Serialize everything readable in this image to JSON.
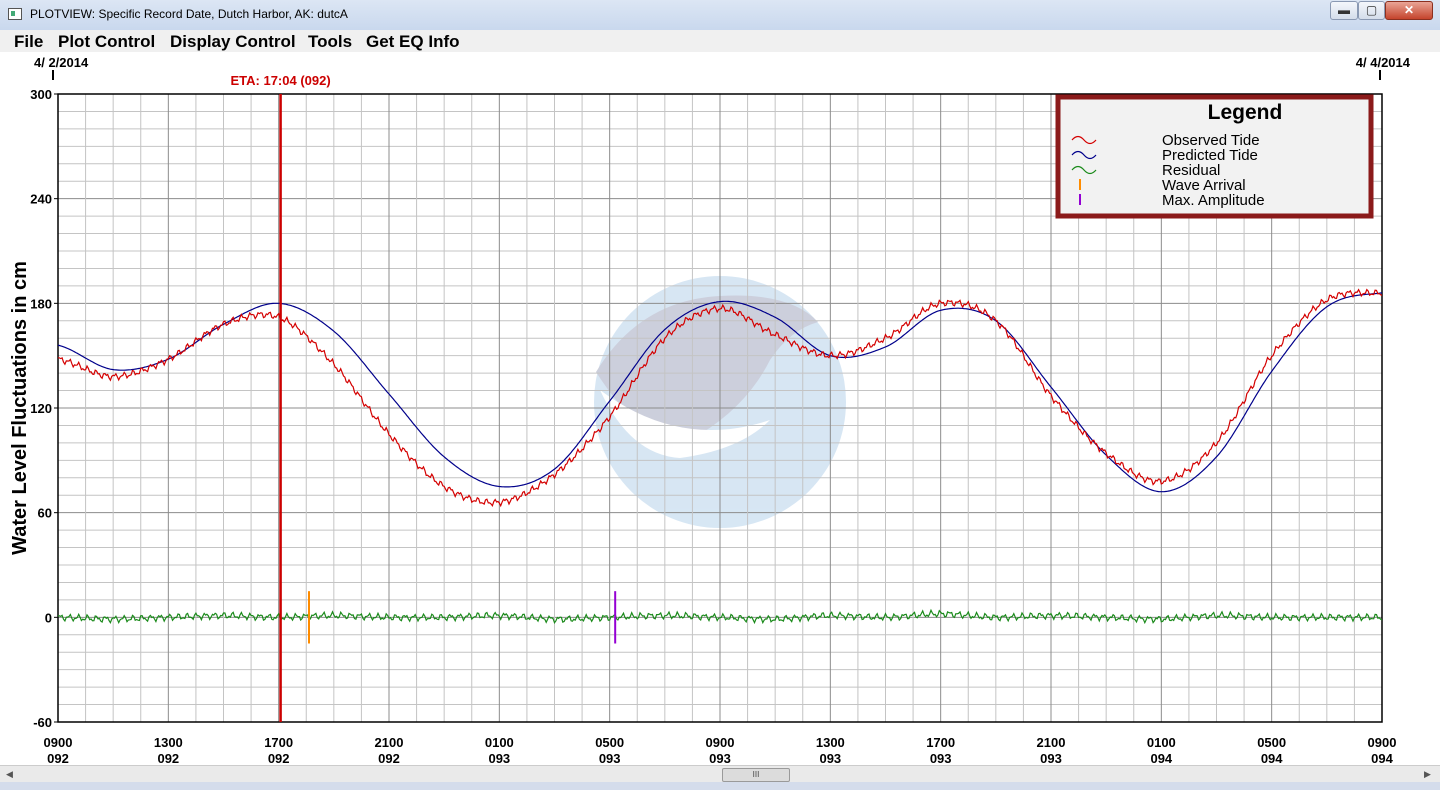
{
  "window": {
    "title": "PLOTVIEW: Specific Record Date, Dutch Harbor, AK: dutcA",
    "minimize_label": "▬",
    "maximize_label": "▢",
    "close_label": "✕"
  },
  "menu": {
    "items": [
      "File",
      "Plot Control",
      "Display Control",
      "Tools",
      "Get EQ Info"
    ]
  },
  "scrollbar": {
    "left_arrow": "◀",
    "right_arrow": "▶",
    "thumb_grip": "III"
  },
  "chart_data": {
    "type": "line",
    "ylabel": "Water Level Fluctuations in cm",
    "ylim": [
      -60,
      300
    ],
    "yticks": [
      -60,
      0,
      60,
      120,
      180,
      240,
      300
    ],
    "xlim_hours": [
      0,
      48
    ],
    "xticks": [
      {
        "hour": 0,
        "time": "0900",
        "day": "092"
      },
      {
        "hour": 4,
        "time": "1300",
        "day": "092"
      },
      {
        "hour": 8,
        "time": "1700",
        "day": "092"
      },
      {
        "hour": 12,
        "time": "2100",
        "day": "092"
      },
      {
        "hour": 16,
        "time": "0100",
        "day": "093"
      },
      {
        "hour": 20,
        "time": "0500",
        "day": "093"
      },
      {
        "hour": 24,
        "time": "0900",
        "day": "093"
      },
      {
        "hour": 28,
        "time": "1300",
        "day": "093"
      },
      {
        "hour": 32,
        "time": "1700",
        "day": "093"
      },
      {
        "hour": 36,
        "time": "2100",
        "day": "093"
      },
      {
        "hour": 40,
        "time": "0100",
        "day": "094"
      },
      {
        "hour": 44,
        "time": "0500",
        "day": "094"
      },
      {
        "hour": 48,
        "time": "0900",
        "day": "094"
      }
    ],
    "date_start": "4/ 2/2014",
    "date_end": "4/ 4/2014",
    "eta": {
      "label": "ETA: 17:04 (092)",
      "hour": 8.07
    },
    "wave_arrival_hour": 9.1,
    "max_amplitude_hour": 20.2,
    "grid": true,
    "legend": {
      "title": "Legend",
      "placement": "top-right",
      "entries": [
        {
          "name": "Observed Tide",
          "color": "#d40000",
          "marker": "wave"
        },
        {
          "name": "Predicted Tide",
          "color": "#00008b",
          "marker": "wave"
        },
        {
          "name": "Residual",
          "color": "#1a8a1a",
          "marker": "wave"
        },
        {
          "name": "Wave Arrival",
          "color": "#ff8c00",
          "marker": "bar"
        },
        {
          "name": "Max. Amplitude",
          "color": "#9400d3",
          "marker": "bar"
        }
      ]
    },
    "series": [
      {
        "name": "Predicted Tide",
        "color": "#00008b",
        "x": [
          0,
          2,
          4,
          6,
          8,
          10,
          12,
          14,
          16,
          18,
          20,
          22,
          24,
          26,
          28,
          30,
          32,
          34,
          36,
          38,
          40,
          42,
          44,
          46,
          48
        ],
        "y": [
          156,
          142,
          148,
          168,
          180,
          164,
          128,
          92,
          75,
          85,
          124,
          165,
          181,
          172,
          150,
          155,
          176,
          170,
          132,
          93,
          72,
          92,
          141,
          178,
          186
        ]
      },
      {
        "name": "Observed Tide",
        "color": "#d40000",
        "x": [
          0,
          2,
          4,
          6,
          8,
          10,
          12,
          14,
          16,
          18,
          20,
          22,
          24,
          26,
          28,
          30,
          32,
          34,
          36,
          38,
          40,
          42,
          44,
          46,
          48
        ],
        "y": [
          148,
          138,
          148,
          168,
          172,
          145,
          105,
          75,
          66,
          82,
          115,
          160,
          177,
          162,
          150,
          160,
          180,
          170,
          127,
          94,
          78,
          100,
          150,
          182,
          186
        ]
      },
      {
        "name": "Residual",
        "color": "#1a8a1a",
        "x": [
          0,
          2,
          4,
          6,
          8,
          10,
          12,
          14,
          16,
          18,
          20,
          22,
          24,
          26,
          28,
          30,
          32,
          34,
          36,
          38,
          40,
          42,
          44,
          46,
          48
        ],
        "y": [
          0,
          -1,
          0,
          1,
          0,
          1,
          0,
          0,
          1,
          -1,
          0,
          1,
          0,
          -1,
          1,
          0,
          2,
          0,
          1,
          0,
          -1,
          1,
          0,
          0,
          0
        ]
      }
    ]
  }
}
